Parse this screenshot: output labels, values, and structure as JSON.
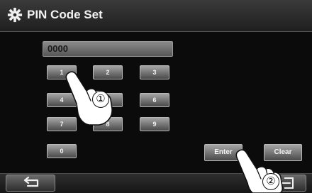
{
  "header": {
    "title": "PIN Code Set",
    "icon": "gear-icon"
  },
  "pin_display": {
    "value": "0000"
  },
  "keypad": {
    "keys": [
      "1",
      "2",
      "3",
      "4",
      "5",
      "6",
      "7",
      "8",
      "9",
      "0"
    ]
  },
  "actions": {
    "enter_label": "Enter",
    "clear_label": "Clear"
  },
  "footer": {
    "back_icon": "back-arrow-icon",
    "exit_icon": "exit-icon"
  },
  "annotations": {
    "step1": "①",
    "step2": "②"
  }
}
